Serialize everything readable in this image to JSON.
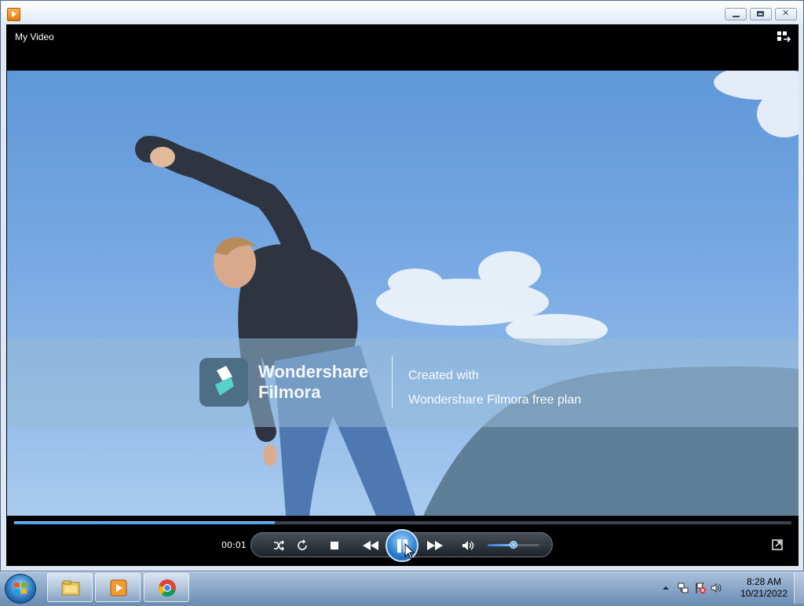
{
  "window": {
    "title": "My Video",
    "buttons": {
      "minimize": "minimize",
      "restore": "restore",
      "close": "close"
    }
  },
  "video": {
    "watermark": {
      "brand_line1": "Wondershare",
      "brand_line2": "Filmora",
      "created_line1": "Created with",
      "created_line2": "Wondershare Filmora free plan"
    }
  },
  "player": {
    "elapsed": "00:01",
    "seek_progress": 0.335,
    "volume_level": 0.5,
    "state": "playing",
    "controls": [
      "shuffle-icon",
      "repeat-icon",
      "stop-icon",
      "previous-icon",
      "pause-icon",
      "next-icon",
      "volume-icon"
    ]
  },
  "taskbar": {
    "pinned": [
      "windows-explorer",
      "windows-media-player",
      "google-chrome"
    ],
    "tray_icons": [
      "show-hidden-icons",
      "network-icon",
      "action-center-flag-icon",
      "speaker-icon"
    ],
    "clock_time": "8:28 AM",
    "clock_date": "10/21/2022"
  },
  "colors": {
    "accent": "#3d86d6",
    "sky": "#79aae3",
    "taskbar": "#8aa9cc"
  }
}
